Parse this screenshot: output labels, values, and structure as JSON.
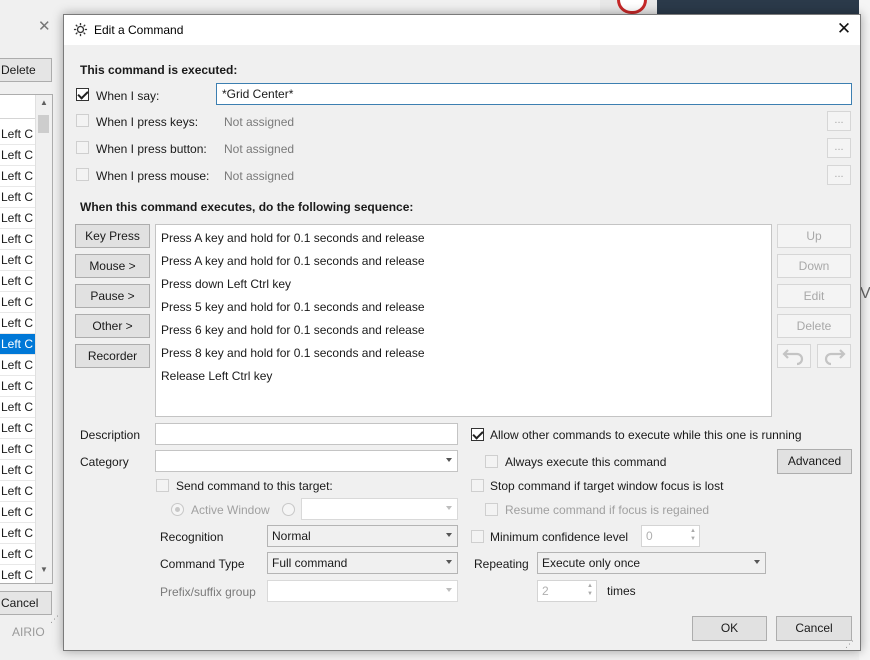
{
  "background": {
    "delete_label": "Delete",
    "cancel_label": "Cancel",
    "airio_text": "AIRIO",
    "list_rows": [
      "Left C",
      "Left C",
      "Left C",
      "Left C",
      "Left C",
      "Left C",
      "Left C",
      "Left C",
      "Left C",
      "Left C",
      "Left C",
      "Left C",
      "Left C",
      "Left C",
      "Left C",
      "Left C",
      "Left C",
      "Left C",
      "Left C",
      "Left C",
      "Left C",
      "Left C",
      "Left C"
    ],
    "selected_row_index": 10,
    "right_fragment": "V"
  },
  "dialog": {
    "title": "Edit a Command",
    "executed_heading": "This command is executed:",
    "triggers": {
      "say": {
        "label": "When I say:",
        "checked": true,
        "value": "*Grid Center*"
      },
      "keys": {
        "label": "When I press keys:",
        "checked": false,
        "value": "Not assigned",
        "button": "..."
      },
      "button": {
        "label": "When I press button:",
        "checked": false,
        "value": "Not assigned",
        "button": "..."
      },
      "mouse": {
        "label": "When I press mouse:",
        "checked": false,
        "value": "Not assigned",
        "button": "..."
      }
    },
    "sequence_heading": "When this command executes, do the following sequence:",
    "left_buttons": {
      "key_press": "Key Press",
      "mouse": "Mouse >",
      "pause": "Pause >",
      "other": "Other >",
      "recorder": "Recorder"
    },
    "sequence": [
      "Press A key and hold for 0.1 seconds and release",
      "Press A key and hold for 0.1 seconds and release",
      "Press down Left Ctrl key",
      "Press 5 key and hold for 0.1 seconds and release",
      "Press 6 key and hold for 0.1 seconds and release",
      "Press 8 key and hold for 0.1 seconds and release",
      "Release Left Ctrl key"
    ],
    "right_buttons": {
      "up": "Up",
      "down": "Down",
      "edit": "Edit",
      "delete": "Delete"
    },
    "description_label": "Description",
    "description_value": "",
    "category_label": "Category",
    "category_value": "",
    "send_target": {
      "label": "Send command to this target:",
      "checked": false,
      "active_window_label": "Active Window"
    },
    "recognition": {
      "label": "Recognition",
      "value": "Normal"
    },
    "command_type": {
      "label": "Command Type",
      "value": "Full command"
    },
    "prefix_suffix": {
      "label": "Prefix/suffix group",
      "value": ""
    },
    "allow_other": {
      "label": "Allow other commands to execute while this one is running",
      "checked": true
    },
    "always_execute": {
      "label": "Always execute this command",
      "checked": false
    },
    "advanced_label": "Advanced",
    "stop_on_focus": {
      "label": "Stop command if target window focus is lost",
      "checked": false
    },
    "resume_on_focus": {
      "label": "Resume command if focus is regained",
      "checked": false
    },
    "min_confidence": {
      "label": "Minimum confidence level",
      "checked": false,
      "value": "0"
    },
    "repeating": {
      "label": "Repeating",
      "value": "Execute only once",
      "times_value": "2",
      "times_label": "times"
    },
    "ok_label": "OK",
    "cancel_label": "Cancel"
  }
}
